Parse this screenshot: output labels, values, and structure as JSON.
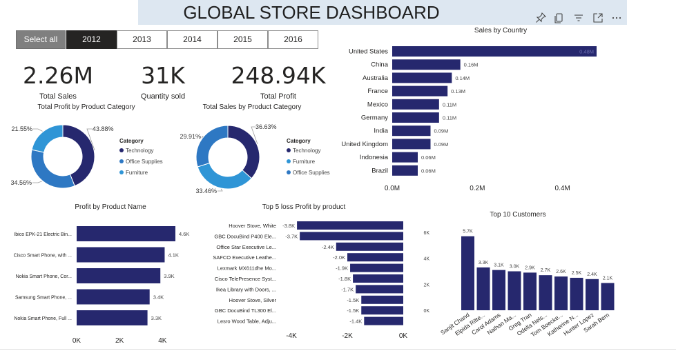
{
  "dashboard": {
    "title": "GLOBAL STORE DASHBOARD",
    "header_icons": [
      "pin-icon",
      "copy-icon",
      "filter-icon",
      "focus-mode-icon",
      "more-options-icon"
    ]
  },
  "slicer": {
    "items": [
      {
        "label": "Select all",
        "state": "select-all"
      },
      {
        "label": "2012",
        "state": "selected"
      },
      {
        "label": "2013",
        "state": "default"
      },
      {
        "label": "2014",
        "state": "default"
      },
      {
        "label": "2015",
        "state": "default"
      },
      {
        "label": "2016",
        "state": "default"
      }
    ]
  },
  "kpis": [
    {
      "value": "2.26M",
      "label": "Total Sales"
    },
    {
      "value": "31K",
      "label": "Quantity sold"
    },
    {
      "value": "248.94K",
      "label": "Total Profit"
    }
  ],
  "colors": {
    "dark_navy": "#26286e",
    "mid_blue": "#2e78c3",
    "light_blue": "#2f95d6",
    "selected_button": "#252423",
    "select_all_button": "#7f7f7f",
    "title_bar": "#dde7f1"
  },
  "chart_data": [
    {
      "id": "profit-by-category",
      "type": "pie",
      "title": "Total Profit by Product Category",
      "legend_title": "Category",
      "legend_position": "right",
      "slices": [
        {
          "name": "Technology",
          "value": 43.88,
          "label": "43.88%",
          "color": "#26286e"
        },
        {
          "name": "Office Supplies",
          "value": 34.56,
          "label": "34.56%",
          "color": "#2e78c3"
        },
        {
          "name": "Furniture",
          "value": 21.55,
          "label": "21.55%",
          "color": "#2f95d6"
        }
      ]
    },
    {
      "id": "sales-by-category",
      "type": "pie",
      "title": "Total Sales by Product Category",
      "legend_title": "Category",
      "legend_position": "right",
      "slices": [
        {
          "name": "Technology",
          "value": 36.63,
          "label": "36.63%",
          "color": "#26286e"
        },
        {
          "name": "Furniture",
          "value": 33.46,
          "label": "33.46%",
          "color": "#2f95d6"
        },
        {
          "name": "Office Supplies",
          "value": 29.91,
          "label": "29.91%",
          "color": "#2e78c3"
        }
      ]
    },
    {
      "id": "sales-by-country",
      "type": "bar",
      "orientation": "horizontal",
      "title": "Sales by Country",
      "categories": [
        "United States",
        "China",
        "Australia",
        "France",
        "Mexico",
        "Germany",
        "India",
        "United Kingdom",
        "Indonesia",
        "Brazil"
      ],
      "values": [
        0.48,
        0.16,
        0.14,
        0.13,
        0.11,
        0.11,
        0.09,
        0.09,
        0.06,
        0.06
      ],
      "data_labels": [
        "0.48M",
        "0.16M",
        "0.14M",
        "0.13M",
        "0.11M",
        "0.11M",
        "0.09M",
        "0.09M",
        "0.06M",
        "0.06M"
      ],
      "xlim": [
        0,
        0.48
      ],
      "xticks": [
        0,
        0.2,
        0.4
      ],
      "xtick_labels": [
        "0.0M",
        "0.2M",
        "0.4M"
      ],
      "grid": false
    },
    {
      "id": "profit-by-product",
      "type": "bar",
      "orientation": "horizontal",
      "title": "Profit by Product Name",
      "categories": [
        "Ibico EPK-21 Electric Bin...",
        "Cisco Smart Phone, with ...",
        "Nokia Smart Phone, Cor...",
        "Samsung Smart Phone, ...",
        "Nokia Smart Phone, Full ..."
      ],
      "values": [
        4.6,
        4.1,
        3.9,
        3.4,
        3.3
      ],
      "data_labels": [
        "4.6K",
        "4.1K",
        "3.9K",
        "3.4K",
        "3.3K"
      ],
      "xlim": [
        0,
        4.6
      ],
      "xticks": [
        0,
        2,
        4
      ],
      "xtick_labels": [
        "0K",
        "2K",
        "4K"
      ],
      "grid": false
    },
    {
      "id": "top-loss-products",
      "type": "bar",
      "orientation": "horizontal",
      "title": "Top 5 loss Profit by product",
      "categories": [
        "Hoover Stove, White",
        "GBC DocuBind P400 Ele...",
        "Office Star Executive Le...",
        "SAFCO Executive Leathe...",
        "Lexmark MX611dhe Mo...",
        "Cisco TelePresence Syst...",
        "Ikea Library with Doors, ...",
        "Hoover Stove, Silver",
        "GBC DocuBind TL300 El...",
        "Lesro Wood Table, Adju..."
      ],
      "values": [
        -3.8,
        -3.7,
        -2.4,
        -2.0,
        -1.9,
        -1.8,
        -1.7,
        -1.5,
        -1.5,
        -1.4
      ],
      "data_labels": [
        "-3.8K",
        "-3.7K",
        "-2.4K",
        "-2.0K",
        "-1.9K",
        "-1.8K",
        "-1.7K",
        "-1.5K",
        "-1.5K",
        "-1.4K"
      ],
      "xlim": [
        -4,
        0
      ],
      "xticks": [
        -4,
        -2,
        0
      ],
      "xtick_labels": [
        "-4K",
        "-2K",
        "0K"
      ],
      "grid": false
    },
    {
      "id": "top-customers",
      "type": "bar",
      "orientation": "vertical",
      "title": "Top 10 Customers",
      "categories": [
        "Sanjit Chand",
        "Elpida Ritte...",
        "Carol Adams",
        "Nathan Ma...",
        "Greg Tran",
        "Odella Nels...",
        "Tom Boecke...",
        "Katherine N...",
        "Hunter Lopez",
        "Sarah Bern"
      ],
      "values": [
        5.7,
        3.3,
        3.1,
        3.0,
        2.9,
        2.7,
        2.6,
        2.5,
        2.4,
        2.1
      ],
      "data_labels": [
        "5.7K",
        "3.3K",
        "3.1K",
        "3.0K",
        "2.9K",
        "2.7K",
        "2.6K",
        "2.5K",
        "2.4K",
        "2.1K"
      ],
      "ylim": [
        0,
        6
      ],
      "yticks": [
        0,
        2,
        4,
        6
      ],
      "ytick_labels": [
        "0K",
        "2K",
        "4K",
        "6K"
      ],
      "grid": false
    }
  ]
}
